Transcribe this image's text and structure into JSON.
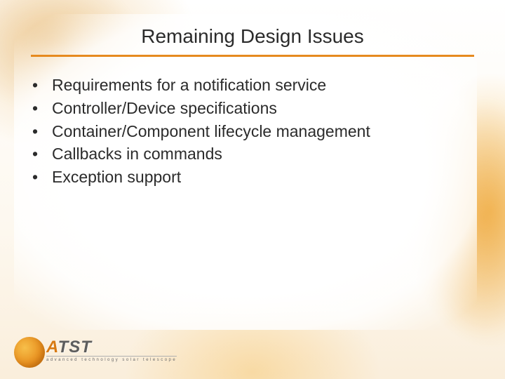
{
  "title": "Remaining Design Issues",
  "bullets": [
    "Requirements for a notification service",
    "Controller/Device specifications",
    "Container/Component lifecycle management",
    "Callbacks in commands",
    "Exception support"
  ],
  "logo": {
    "acronym_pre": "A",
    "acronym_post": "TST",
    "subtitle": "advanced technology solar telescope"
  }
}
